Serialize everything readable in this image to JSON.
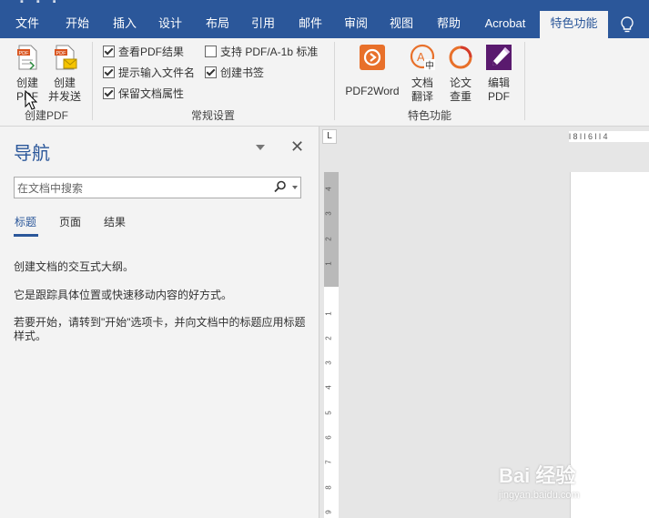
{
  "tabs": [
    "文件",
    "开始",
    "插入",
    "设计",
    "布局",
    "引用",
    "邮件",
    "审阅",
    "视图",
    "帮助",
    "Acrobat",
    "特色功能"
  ],
  "active_tab": "特色功能",
  "ribbon": {
    "create_pdf_group": {
      "label": "创建PDF",
      "btn_create_pdf": [
        "创建",
        "PDF"
      ],
      "btn_create_send": [
        "创建",
        "并发送"
      ]
    },
    "general_group": {
      "label": "常规设置",
      "options": [
        {
          "label": "查看PDF结果",
          "checked": true
        },
        {
          "label": "支持 PDF/A-1b 标准",
          "checked": false
        },
        {
          "label": "提示输入文件名",
          "checked": true
        },
        {
          "label": "创建书签",
          "checked": true
        },
        {
          "label": "保留文档属性",
          "checked": true
        }
      ]
    },
    "features_group": {
      "label": "特色功能",
      "btn_pdf2word": "PDF2Word",
      "btn_translate": [
        "文档",
        "翻译"
      ],
      "btn_check": [
        "论文",
        "查重"
      ],
      "btn_edit": [
        "编辑",
        "PDF"
      ]
    }
  },
  "nav": {
    "title": "导航",
    "close": "✕",
    "search_placeholder": "在文档中搜索",
    "tabs": [
      "标题",
      "页面",
      "结果"
    ],
    "active_tab": "标题",
    "text1": "创建文档的交互式大纲。",
    "text2": "它是跟踪具体位置或快速移动内容的好方式。",
    "text3": "若要开始，请转到\"开始\"选项卡，并向文档中的标题应用标题样式。"
  },
  "ruler": {
    "corner": "L",
    "h_marks": "l 8 l   l 6 l   l 4",
    "v_numbers": [
      "4",
      "3",
      "2",
      "1",
      "",
      "1",
      "2",
      "3",
      "4",
      "5",
      "6",
      "7",
      "8",
      "9"
    ]
  },
  "watermark": {
    "main": "Bai 经验",
    "sub": "jingyan.baidu.com"
  },
  "colors": {
    "accent": "#2b579a",
    "ribbon": "#f3f3f3",
    "acrobat_red": "#d9541e",
    "edit_purple": "#5a1a6e"
  }
}
